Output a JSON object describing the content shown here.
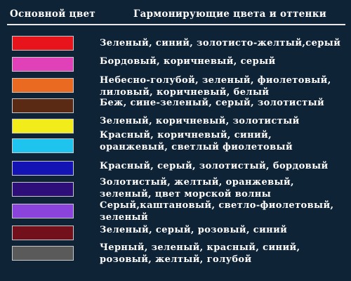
{
  "header": {
    "left_label": "Основной цвет",
    "right_label": "Гармонирующие цвета и оттенки"
  },
  "rows": [
    {
      "color": "#e8141c",
      "line1": "Зеленый, синий, золотисто-желтый,серый",
      "line2": ""
    },
    {
      "color": "#e040b8",
      "line1": "Бордовый, коричневый, серый",
      "line2": ""
    },
    {
      "color": "#ea6a22",
      "line1": "Небесно-голубой, зеленый, фиолетовый,",
      "line2": "лиловый, коричневый, белый"
    },
    {
      "color": "#5a2a14",
      "line1": "Беж, сине-зеленый, серый, золотистый",
      "line2": ""
    },
    {
      "color": "#f2ec1a",
      "line1": "Зеленый, коричневый, золотистый",
      "line2": ""
    },
    {
      "color": "#1ec4ee",
      "line1": "Красный, коричневый, синий,",
      "line2": "оранжевый, светлый фиолетовый"
    },
    {
      "color": "#1414b4",
      "line1": "Красный, серый, золотистый, бордовый",
      "line2": ""
    },
    {
      "color": "#2e0e78",
      "line1": "Золотистый, желтый, оранжевый,",
      "line2": "зеленый, цвет морской волны"
    },
    {
      "color": "#8a44dc",
      "line1": "Серый,каштановый, светло-фиолетовый,",
      "line2": "зеленый"
    },
    {
      "color": "#72101c",
      "line1": "Зеленый, серый, розовый, синий",
      "line2": ""
    },
    {
      "color": "#5a5a5a",
      "line1": "Черный, зеленый, красный, синий,",
      "line2": "розовый, желтый, голубой"
    }
  ]
}
